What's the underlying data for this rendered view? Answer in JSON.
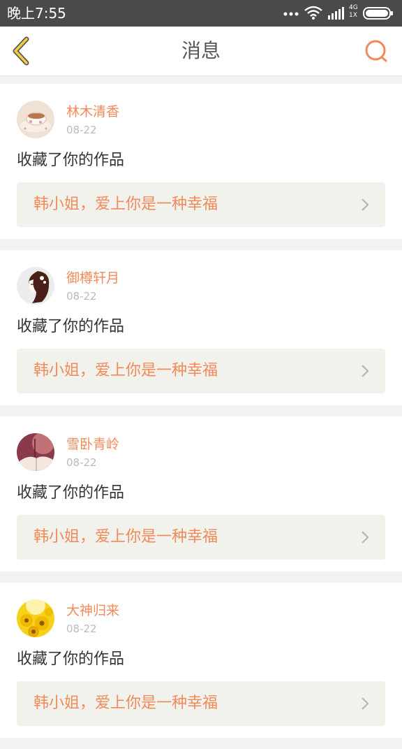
{
  "status_bar": {
    "time": "晚上7:55",
    "network_top": "4G",
    "network_bottom": "1X",
    "icons": [
      "more-dots-icon",
      "wifi-icon",
      "signal-icon",
      "battery-icon"
    ]
  },
  "header": {
    "title": "消息",
    "back_icon": "chevron-left-icon",
    "search_icon": "search-icon"
  },
  "colors": {
    "accent": "#f08a5a",
    "back_icon": "#f0d040",
    "link_bg": "#f2f2ec"
  },
  "messages": [
    {
      "username": "林木清香",
      "date": "08-22",
      "action": "收藏了你的作品",
      "work_title": "韩小姐，爱上你是一种幸福"
    },
    {
      "username": "御樽轩月",
      "date": "08-22",
      "action": "收藏了你的作品",
      "work_title": "韩小姐，爱上你是一种幸福"
    },
    {
      "username": "雪卧青岭",
      "date": "08-22",
      "action": "收藏了你的作品",
      "work_title": "韩小姐，爱上你是一种幸福"
    },
    {
      "username": "大神归来",
      "date": "08-22",
      "action": "收藏了你的作品",
      "work_title": "韩小姐，爱上你是一种幸福"
    }
  ]
}
